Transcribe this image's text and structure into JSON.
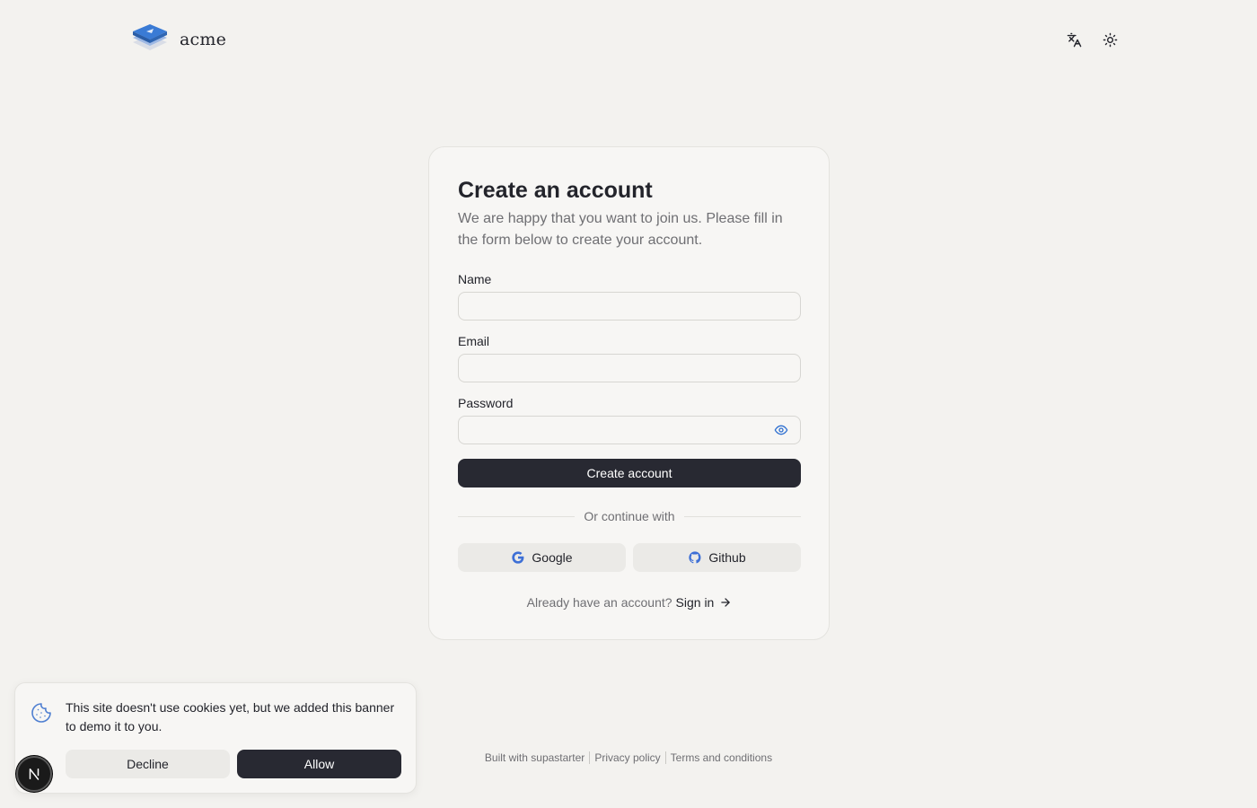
{
  "header": {
    "brand": "acme",
    "language_icon": "language-icon",
    "theme_icon": "sun-icon"
  },
  "form": {
    "title": "Create an account",
    "subtitle": "We are happy that you want to join us. Please fill in the form below to create your account.",
    "name_label": "Name",
    "name_value": "",
    "email_label": "Email",
    "email_value": "",
    "password_label": "Password",
    "password_value": "",
    "submit_label": "Create account",
    "divider_text": "Or continue with",
    "google_label": "Google",
    "github_label": "Github",
    "signin_prompt": "Already have an account?",
    "signin_link": "Sign in"
  },
  "footer": {
    "built_with": "Built with supastarter",
    "privacy": "Privacy policy",
    "terms": "Terms and conditions"
  },
  "cookie_banner": {
    "message": "This site doesn't use cookies yet, but we added this banner to demo it to you.",
    "decline_label": "Decline",
    "allow_label": "Allow"
  },
  "colors": {
    "background": "#f3f2ef",
    "primary": "#282932",
    "brand_blue": "#3a7bd5"
  }
}
